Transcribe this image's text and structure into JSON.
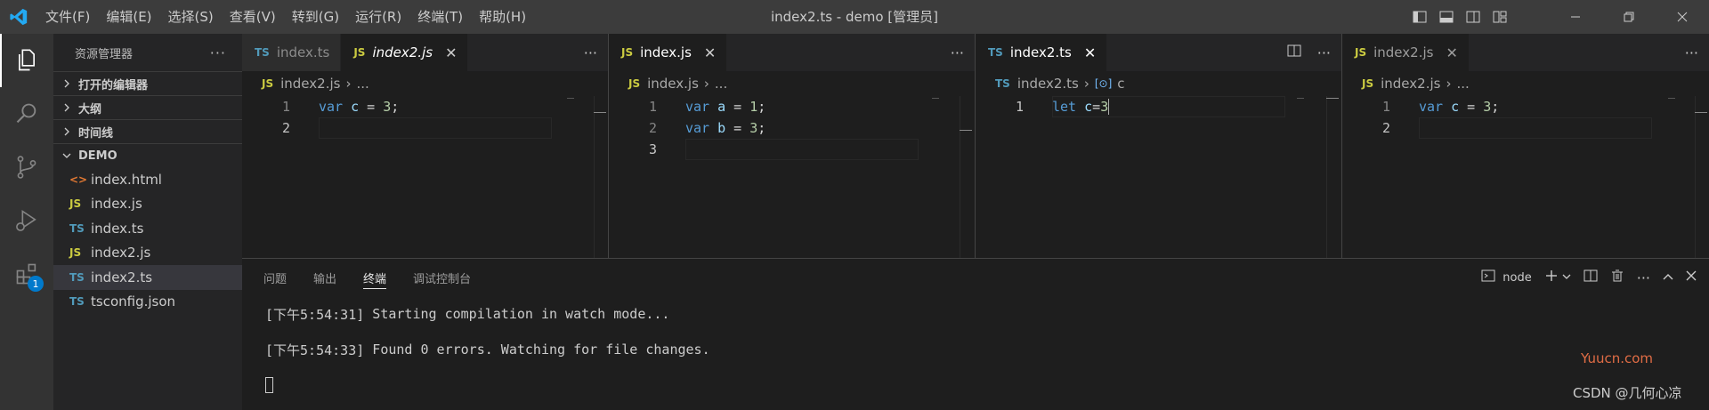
{
  "titlebar": {
    "menu": [
      "文件(F)",
      "编辑(E)",
      "选择(S)",
      "查看(V)",
      "转到(G)",
      "运行(R)",
      "终端(T)",
      "帮助(H)"
    ],
    "title": "index2.ts - demo [管理员]"
  },
  "activity": {
    "extensions_badge": "1"
  },
  "sidebar": {
    "header": "资源管理器",
    "sections": [
      "打开的编辑器",
      "大纲",
      "时间线",
      "DEMO"
    ],
    "files": [
      {
        "icon": "<>",
        "name": "index.html",
        "color": "#e37933"
      },
      {
        "icon": "JS",
        "name": "index.js",
        "color": "#cbcb41"
      },
      {
        "icon": "TS",
        "name": "index.ts",
        "color": "#519aba"
      },
      {
        "icon": "JS",
        "name": "index2.js",
        "color": "#cbcb41"
      },
      {
        "icon": "TS",
        "name": "index2.ts",
        "color": "#519aba"
      },
      {
        "icon": "TS",
        "name": "tsconfig.json",
        "color": "#519aba"
      }
    ]
  },
  "groups": [
    {
      "tabs": [
        {
          "icon": "TS",
          "label": "index.ts"
        },
        {
          "icon": "JS",
          "label": "index2.js"
        }
      ],
      "breadcrumb": {
        "icon": "JS",
        "file": "index2.js",
        "rest": "..."
      },
      "lines": [
        {
          "n": "1",
          "kw": "var",
          "v": "c",
          "op": " = ",
          "num": "3",
          "end": ";"
        },
        {
          "n": "2",
          "kw": "",
          "v": "",
          "op": "",
          "num": "",
          "end": ""
        }
      ]
    },
    {
      "tabs": [
        {
          "icon": "JS",
          "label": "index.js"
        }
      ],
      "breadcrumb": {
        "icon": "JS",
        "file": "index.js",
        "rest": "..."
      },
      "lines": [
        {
          "n": "1",
          "kw": "var",
          "v": "a",
          "op": " = ",
          "num": "1",
          "end": ";"
        },
        {
          "n": "2",
          "kw": "var",
          "v": "b",
          "op": " = ",
          "num": "3",
          "end": ";"
        },
        {
          "n": "3",
          "kw": "",
          "v": "",
          "op": "",
          "num": "",
          "end": ""
        }
      ]
    },
    {
      "tabs": [
        {
          "icon": "TS",
          "label": "index2.ts"
        }
      ],
      "breadcrumb": {
        "icon": "TS",
        "file": "index2.ts",
        "symbol": "c"
      },
      "lines": [
        {
          "n": "1",
          "kw": "let",
          "v": "c",
          "op": "=",
          "num": "3",
          "end": ""
        }
      ]
    },
    {
      "tabs": [
        {
          "icon": "JS",
          "label": "index2.js"
        }
      ],
      "breadcrumb": {
        "icon": "JS",
        "file": "index2.js",
        "rest": "..."
      },
      "lines": [
        {
          "n": "1",
          "kw": "var",
          "v": "c",
          "op": " = ",
          "num": "3",
          "end": ";"
        },
        {
          "n": "2",
          "kw": "",
          "v": "",
          "op": "",
          "num": "",
          "end": ""
        }
      ]
    }
  ],
  "panel": {
    "tabs": [
      "问题",
      "输出",
      "终端",
      "调试控制台"
    ],
    "terminal_name": "node",
    "lines": [
      {
        "time": "[下午5:54:31]",
        "text": " Starting compilation in watch mode..."
      },
      {
        "time": "[下午5:54:33]",
        "text": " Found 0 errors. Watching for file changes."
      }
    ]
  },
  "watermarks": {
    "site": "Yuucn.com",
    "author": "CSDN @几何心凉"
  }
}
